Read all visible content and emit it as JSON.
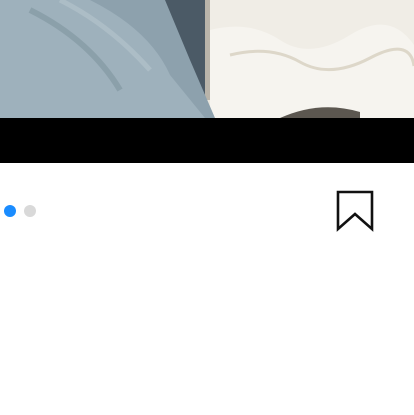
{
  "media": {
    "image": "photo-preview",
    "carousel_total": 2,
    "carousel_active_index": 0
  },
  "colors": {
    "active_dot": "#1a8cff",
    "inactive_dot": "#d9d9d9",
    "bar": "#000000"
  },
  "icons": {
    "save": "bookmark-icon"
  }
}
